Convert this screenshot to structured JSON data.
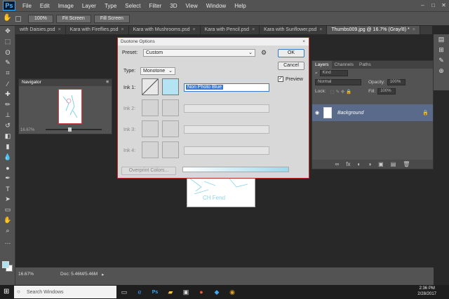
{
  "app": {
    "logo": "Ps"
  },
  "menu": [
    "File",
    "Edit",
    "Image",
    "Layer",
    "Type",
    "Select",
    "Filter",
    "3D",
    "View",
    "Window",
    "Help"
  ],
  "window_controls": [
    "–",
    "□",
    "✕"
  ],
  "options_bar": {
    "zoom_button": "100%",
    "fit_screen": "Fit Screen",
    "fill_screen": "Fill Screen"
  },
  "tabs": [
    {
      "label": "with Daisies.psd",
      "active": false
    },
    {
      "label": "Kara with Fireflies.psd",
      "active": false
    },
    {
      "label": "Kara with Mushrooms.psd",
      "active": false
    },
    {
      "label": "Kara with Pencil.psd",
      "active": false
    },
    {
      "label": "Kara with Sunflower.psd",
      "active": false
    },
    {
      "label": "Thumbs009.jpg @ 16.7% (Gray/8) *",
      "active": true
    }
  ],
  "navigator": {
    "title": "Navigator",
    "zoom": "16.67%"
  },
  "layers_panel": {
    "tabs": [
      "Layers",
      "Channels",
      "Paths"
    ],
    "kind": "Kind",
    "blend_mode": "Normal",
    "opacity_label": "Opacity:",
    "opacity": "100%",
    "lock_label": "Lock:",
    "fill_label": "Fill:",
    "fill": "100%",
    "layer_name": "Background",
    "footer_icons": [
      "∞",
      "fx",
      "◐",
      "◑",
      "▣",
      "▤",
      "🗑"
    ]
  },
  "statusbar": {
    "zoom": "16.67%",
    "doc": "Doc: 5.46M/5.46M"
  },
  "canvas_text": "CH Fend",
  "dialog": {
    "title": "Duotone Options",
    "preset_label": "Preset:",
    "preset_value": "Custom",
    "type_label": "Type:",
    "type_value": "Monotone",
    "ink1_label": "Ink 1:",
    "ink1_name": "Non Photo Blue",
    "ink2_label": "Ink 2:",
    "ink3_label": "Ink 3:",
    "ink4_label": "Ink 4:",
    "ok": "OK",
    "cancel": "Cancel",
    "preview": "Preview",
    "preview_checked": true,
    "overprint": "Overprint Colors...",
    "ink_color": "#b4e4f2"
  },
  "taskbar": {
    "search_placeholder": "Search Windows",
    "time": "2:36 PM",
    "date": "2/28/2017"
  }
}
